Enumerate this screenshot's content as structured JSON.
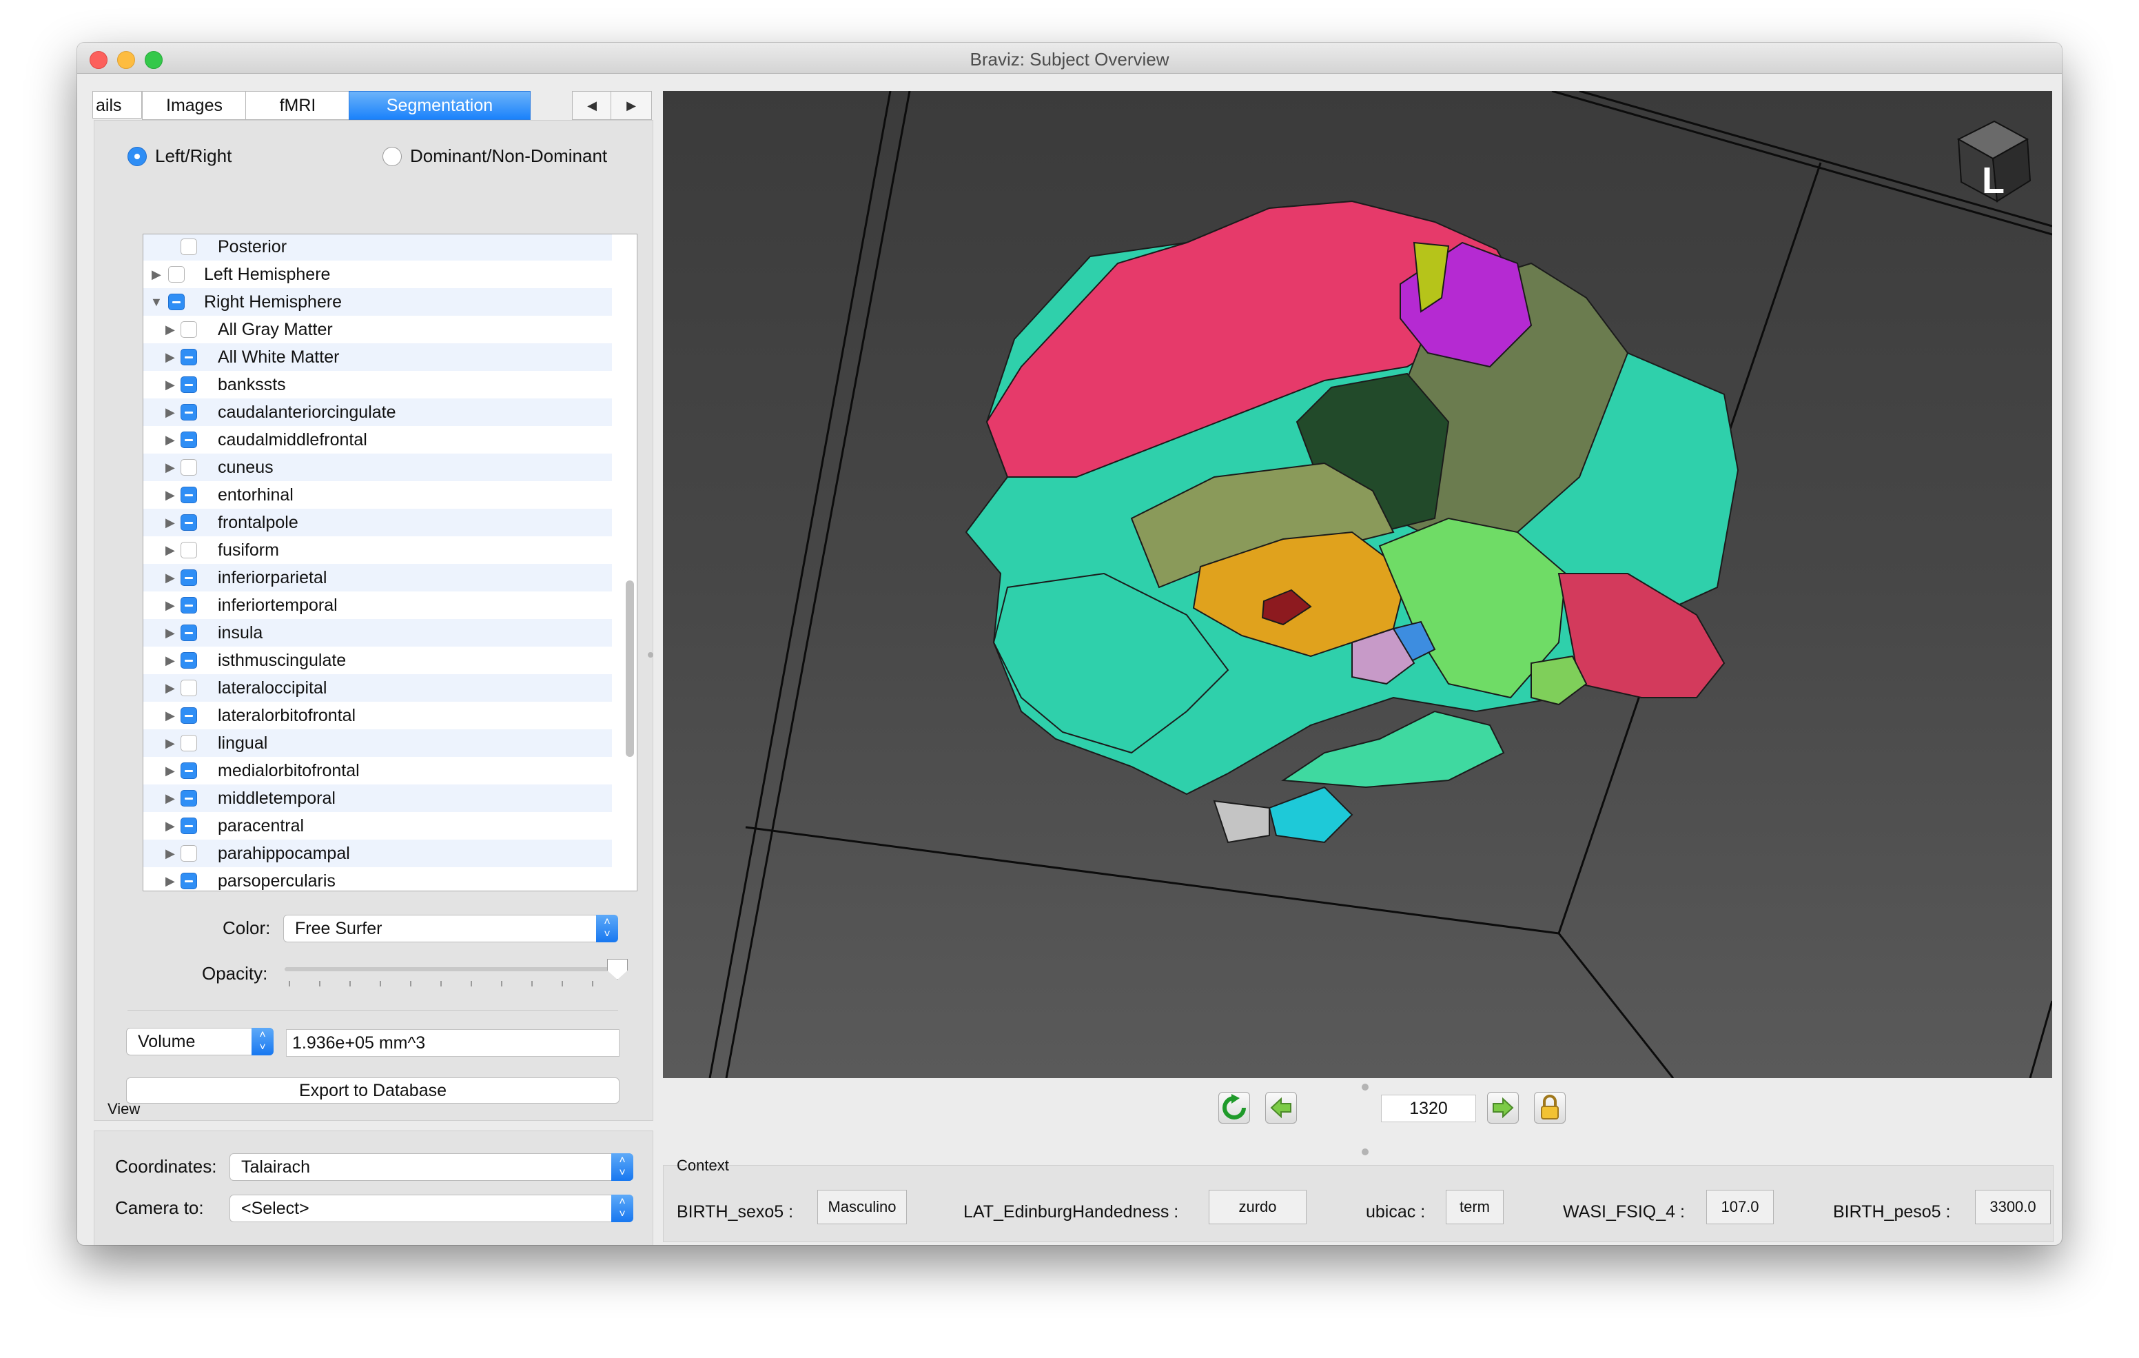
{
  "window": {
    "title": "Braviz: Subject Overview"
  },
  "tabs": [
    {
      "label": "ails"
    },
    {
      "label": "Images"
    },
    {
      "label": "fMRI"
    },
    {
      "label": "Segmentation",
      "active": true
    }
  ],
  "tab_nav": {
    "prev": "◀",
    "next": "▶"
  },
  "side_mode": {
    "option1": "Left/Right",
    "option2": "Dominant/Non-Dominant",
    "selected": "Left/Right"
  },
  "tree": {
    "rows": [
      {
        "label": "Posterior",
        "checked": false
      },
      {
        "label": "Left Hemisphere",
        "checked": false
      },
      {
        "label": "Right Hemisphere",
        "checked": true
      },
      {
        "label": "All Gray Matter",
        "checked": false
      },
      {
        "label": "All White Matter",
        "checked": true
      },
      {
        "label": "bankssts",
        "checked": true
      },
      {
        "label": "caudalanteriorcingulate",
        "checked": true
      },
      {
        "label": "caudalmiddlefrontal",
        "checked": true
      },
      {
        "label": "cuneus",
        "checked": false
      },
      {
        "label": "entorhinal",
        "checked": true
      },
      {
        "label": "frontalpole",
        "checked": true
      },
      {
        "label": "fusiform",
        "checked": false
      },
      {
        "label": "inferiorparietal",
        "checked": true
      },
      {
        "label": "inferiortemporal",
        "checked": true
      },
      {
        "label": "insula",
        "checked": true
      },
      {
        "label": "isthmuscingulate",
        "checked": true
      },
      {
        "label": "lateraloccipital",
        "checked": false
      },
      {
        "label": "lateralorbitofrontal",
        "checked": true
      },
      {
        "label": "lingual",
        "checked": false
      },
      {
        "label": "medialorbitofrontal",
        "checked": true
      },
      {
        "label": "middletemporal",
        "checked": true
      },
      {
        "label": "paracentral",
        "checked": true
      },
      {
        "label": "parahippocampal",
        "checked": false
      },
      {
        "label": "parsopercularis",
        "checked": true
      }
    ]
  },
  "color": {
    "label": "Color:",
    "value": "Free Surfer"
  },
  "opacity": {
    "label": "Opacity:",
    "value": 1.0
  },
  "metric": {
    "value": "Volume",
    "result": "1.936e+05 mm^3"
  },
  "export_button": "Export to Database",
  "view": {
    "title": "View",
    "coordinates_label": "Coordinates:",
    "coordinates_value": "Talairach",
    "camera_label": "Camera to:",
    "camera_value": "<Select>"
  },
  "viewport": {
    "orientation_label": "L"
  },
  "playback": {
    "frame": "1320"
  },
  "context": {
    "title": "Context",
    "vars": [
      {
        "label": "BIRTH_sexo5 :",
        "value": "Masculino"
      },
      {
        "label": "LAT_EdinburgHandedness :",
        "value": "zurdo"
      },
      {
        "label": "ubicac :",
        "value": "term"
      },
      {
        "label": "WASI_FSIQ_4 :",
        "value": "107.0"
      },
      {
        "label": "BIRTH_peso5 :",
        "value": "3300.0"
      }
    ]
  },
  "colors": {
    "accent": "#2f8ef5",
    "viewport_bg": "#444444",
    "tree_alt_row": "#edf3fd"
  }
}
